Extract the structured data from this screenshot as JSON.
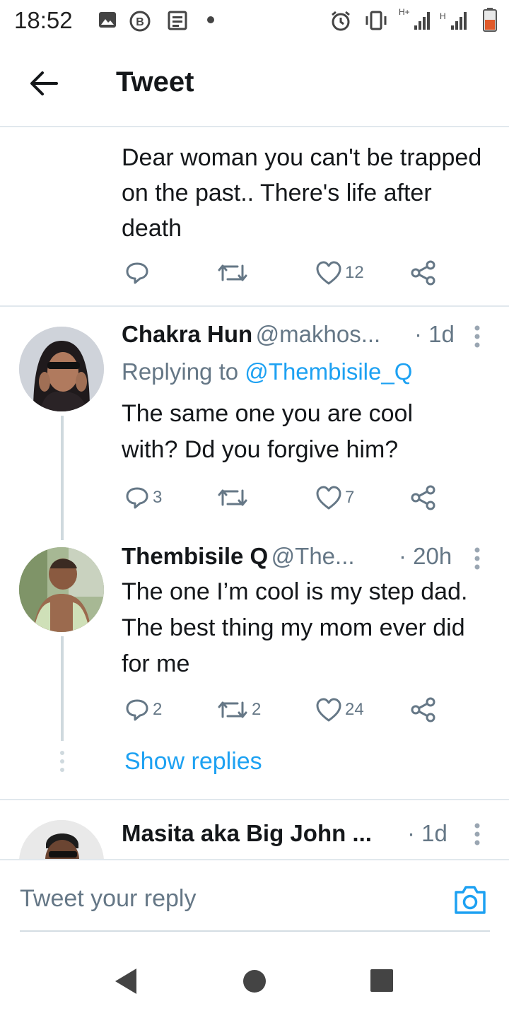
{
  "status_bar": {
    "time": "18:52",
    "icons": [
      "image-icon",
      "b-icon",
      "news-icon",
      "dot-icon",
      "alarm-icon",
      "vibrate-icon",
      "signal-icon",
      "signal-icon",
      "battery-icon"
    ],
    "net1": "H+",
    "net2": "H"
  },
  "header": {
    "title": "Tweet"
  },
  "main_tweet": {
    "text": "Dear woman you can't be trapped on the past.. There's life after death",
    "reply_count": "",
    "retweet_count": "",
    "like_count": "12"
  },
  "replies": [
    {
      "name": "Chakra Hun",
      "handle": "@makhos...",
      "time": "· 1d",
      "replying_label": "Replying to",
      "replying_to": "@Thembisile_Q",
      "text": "The same one you are cool with? Dd you forgive him?",
      "reply_count": "3",
      "retweet_count": "",
      "like_count": "7"
    },
    {
      "name": "Thembisile Q",
      "handle": "@The...",
      "time": "· 20h",
      "text": "The one I’m cool is my step dad. The best thing my mom ever did for me",
      "reply_count": "2",
      "retweet_count": "2",
      "like_count": "24"
    },
    {
      "name": "Masita aka Big John ...",
      "time": "· 1d"
    }
  ],
  "show_replies": "Show replies",
  "reply_box": {
    "placeholder": "Tweet your reply"
  },
  "colors": {
    "accent": "#1da1f2",
    "text": "#14171a",
    "muted": "#657786",
    "divider": "#e1e8ed"
  }
}
